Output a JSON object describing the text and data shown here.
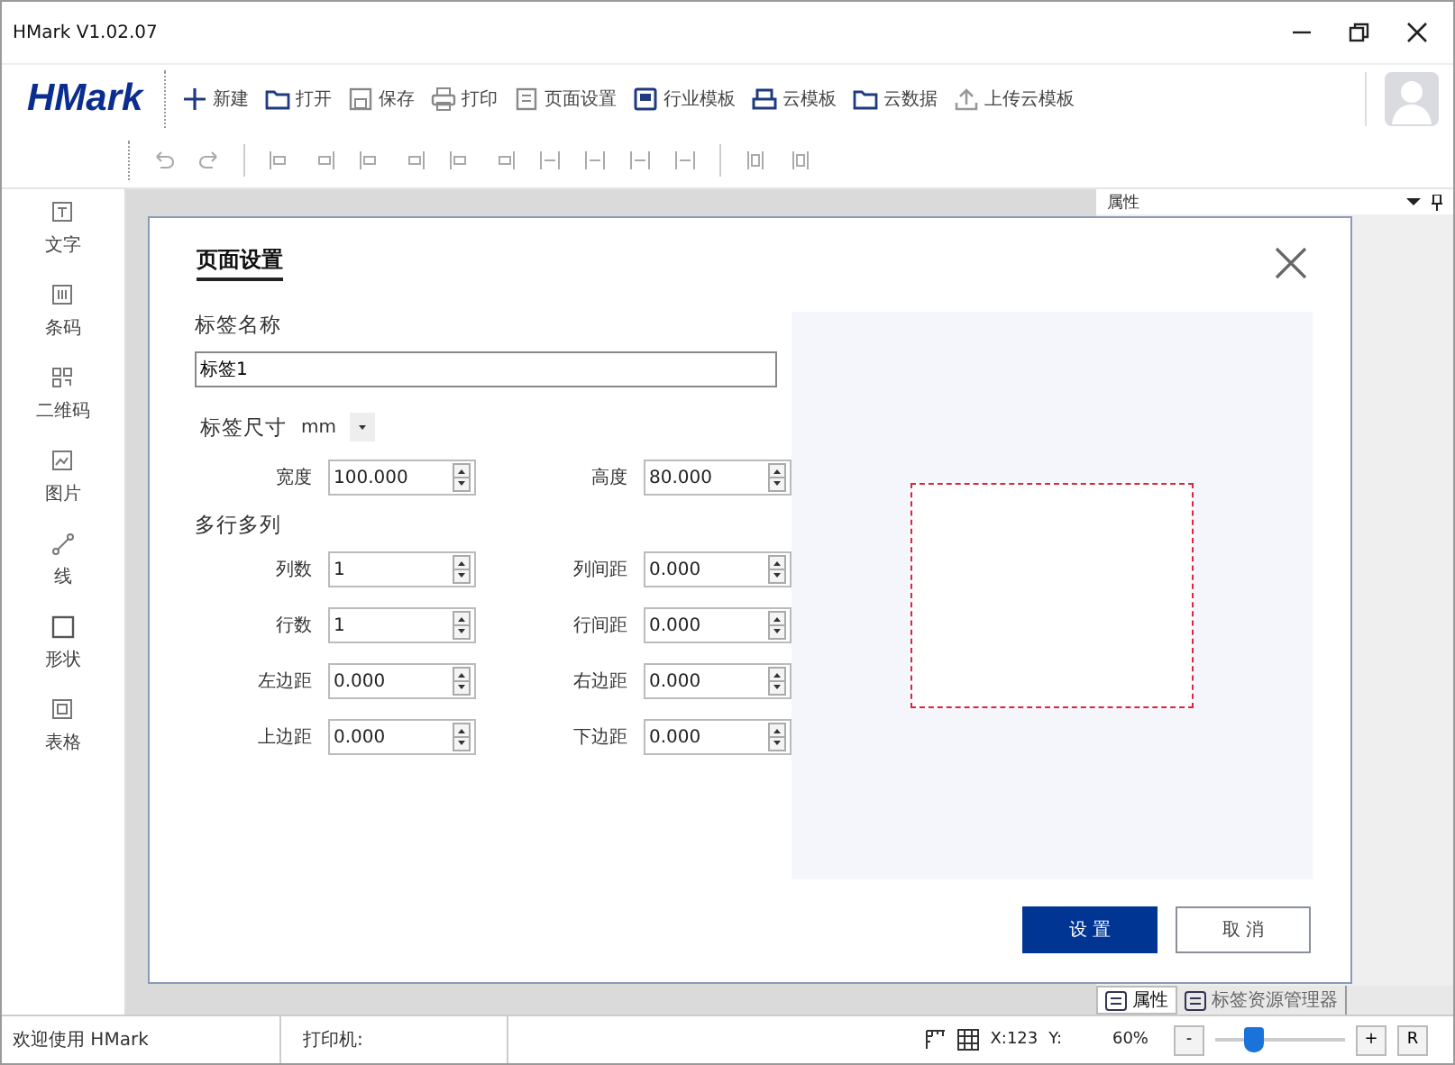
{
  "window": {
    "title": "HMark V1.02.07"
  },
  "logo": "HMark",
  "toolbar": [
    {
      "label": "新建"
    },
    {
      "label": "打开"
    },
    {
      "label": "保存"
    },
    {
      "label": "打印"
    },
    {
      "label": "页面设置"
    },
    {
      "label": "行业模板"
    },
    {
      "label": "云模板"
    },
    {
      "label": "云数据"
    },
    {
      "label": "上传云模板"
    }
  ],
  "sidebar": {
    "items": [
      {
        "label": "文字"
      },
      {
        "label": "条码"
      },
      {
        "label": "二维码"
      },
      {
        "label": "图片"
      },
      {
        "label": "线"
      },
      {
        "label": "形状"
      },
      {
        "label": "表格"
      }
    ]
  },
  "right_panel": {
    "title": "属性"
  },
  "dialog": {
    "title": "页面设置",
    "name_label": "标签名称",
    "name_value": "标签1",
    "size_label": "标签尺寸",
    "unit": "mm",
    "section": "多行多列",
    "fields": [
      {
        "label": "宽度",
        "value": "100.000"
      },
      {
        "label": "高度",
        "value": "80.000"
      },
      {
        "label": "列数",
        "value": "1"
      },
      {
        "label": "列间距",
        "value": "0.000"
      },
      {
        "label": "行数",
        "value": "1"
      },
      {
        "label": "行间距",
        "value": "0.000"
      },
      {
        "label": "左边距",
        "value": "0.000"
      },
      {
        "label": "右边距",
        "value": "0.000"
      },
      {
        "label": "上边距",
        "value": "0.000"
      },
      {
        "label": "下边距",
        "value": "0.000"
      }
    ],
    "buttons": [
      {
        "label": "设 置",
        "kind": "primary"
      },
      {
        "label": "取 消",
        "kind": "secondary"
      }
    ]
  },
  "bottom_tabs": [
    {
      "label": "属性",
      "selected": true
    },
    {
      "label": "标签资源管理器",
      "selected": false
    }
  ],
  "status_bar": {
    "welcome": "欢迎使用 HMark",
    "printer": "打印机:",
    "x": "X:123",
    "y": "Y:",
    "zoom": "60%",
    "zoom_slider": {
      "level": 0.3
    },
    "zoom_out": "-",
    "zoom_in": "+",
    "reset": "R"
  }
}
